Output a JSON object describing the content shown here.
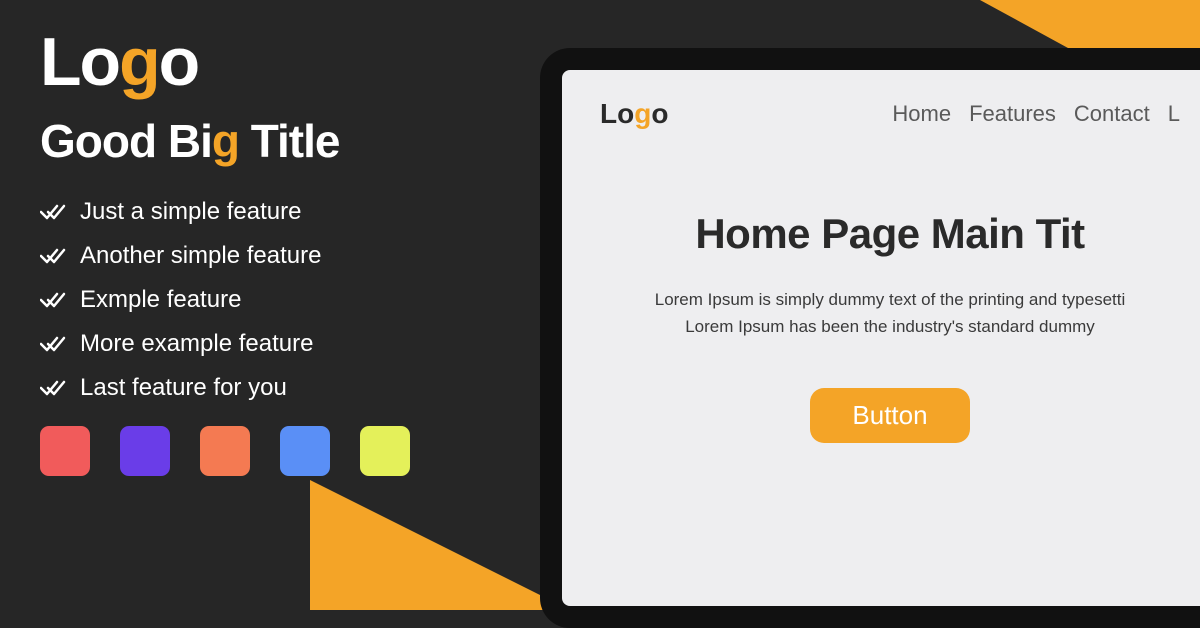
{
  "left": {
    "logo_pre": "Lo",
    "logo_accent": "g",
    "logo_post": "o",
    "title_pre": "Good Bi",
    "title_accent": "g",
    "title_post": " Title",
    "features": [
      "Just a simple feature",
      "Another simple feature",
      "Exmple feature",
      "More example feature",
      "Last feature for you"
    ],
    "swatches": [
      "#f15b5b",
      "#6a3de8",
      "#f47a52",
      "#5a8ff6",
      "#e4f05a"
    ]
  },
  "mock": {
    "logo_pre": "Lo",
    "logo_accent": "g",
    "logo_post": "o",
    "nav": [
      "Home",
      "Features",
      "Contact",
      "L"
    ],
    "title": "Home Page Main Tit",
    "desc_line1": "Lorem Ipsum is simply dummy text of the printing and typesetti",
    "desc_line2": "Lorem Ipsum has been the industry's standard dummy",
    "button": "Button"
  }
}
